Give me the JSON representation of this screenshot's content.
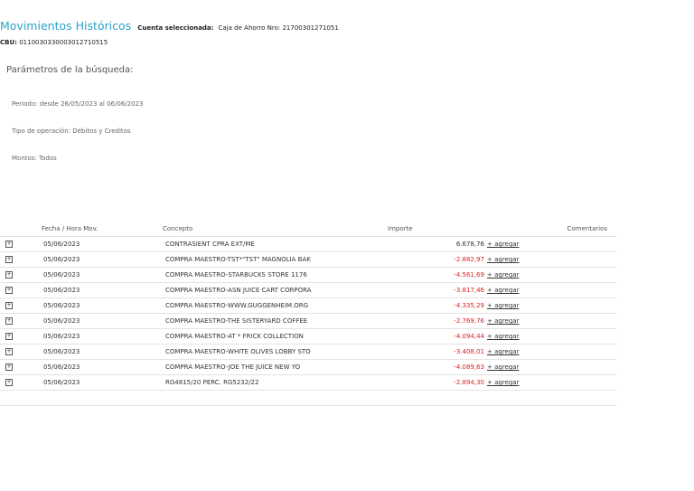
{
  "header": {
    "title": "Movimientos Históricos",
    "account_label": "Cuenta seleccionada:",
    "account_value": "Caja de Ahorro Nro: 21700301271051",
    "cbu_label": "CBU:",
    "cbu_value": "0110030330003012710515"
  },
  "params": {
    "title": "Parámetros de la búsqueda:",
    "periodo": "Periodo: desde 26/05/2023 al 06/06/2023",
    "tipo": "Tipo de operación: Débitos y Creditos",
    "montos": "Montos: Todos"
  },
  "table": {
    "headers": {
      "date": "Fecha / Hora Mov.",
      "concept": "Concepto",
      "amount": "Importe",
      "comments": "Comentarios"
    },
    "add_label": "+ agregar",
    "rows": [
      {
        "date": "05/06/2023",
        "concept": "CONTRASIENT CPRA EXT/ME",
        "amount": "6.678,76",
        "negative": false
      },
      {
        "date": "05/06/2023",
        "concept": "COMPRA MAESTRO-TST*\"TST\" MAGNOLIA BAK",
        "amount": "-2.882,97",
        "negative": true
      },
      {
        "date": "05/06/2023",
        "concept": "COMPRA MAESTRO-STARBUCKS STORE 1176",
        "amount": "-4.561,69",
        "negative": true
      },
      {
        "date": "05/06/2023",
        "concept": "COMPRA MAESTRO-ASN JUICE CART CORPORA",
        "amount": "-3.817,46",
        "negative": true
      },
      {
        "date": "05/06/2023",
        "concept": "COMPRA MAESTRO-WWW.GUGGENHEIM.ORG",
        "amount": "-4.335,29",
        "negative": true
      },
      {
        "date": "05/06/2023",
        "concept": "COMPRA MAESTRO-THE SISTERYARD COFFEE",
        "amount": "-2.769,76",
        "negative": true
      },
      {
        "date": "05/06/2023",
        "concept": "COMPRA MAESTRO-AT * FRICK COLLECTION",
        "amount": "-4.094,44",
        "negative": true
      },
      {
        "date": "05/06/2023",
        "concept": "COMPRA MAESTRO-WHITE OLIVES LOBBY STO",
        "amount": "-3.408,01",
        "negative": true
      },
      {
        "date": "05/06/2023",
        "concept": "COMPRA MAESTRO-JOE THE JUICE NEW YO",
        "amount": "-4.089,63",
        "negative": true
      },
      {
        "date": "05/06/2023",
        "concept": "RG4815/20 PERC. RG5232/22",
        "amount": "-2.894,30",
        "negative": true
      }
    ]
  },
  "icons": {
    "expand": "plus-box-icon"
  },
  "colors": {
    "title": "#2aa3c8",
    "negative": "#e02020"
  }
}
